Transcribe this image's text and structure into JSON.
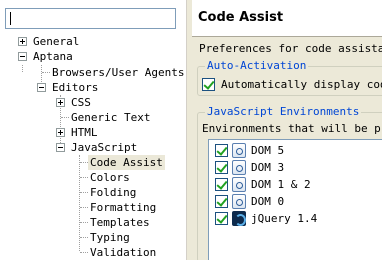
{
  "filter": {
    "value": ""
  },
  "tree": [
    {
      "label": "General",
      "expander": "plus"
    },
    {
      "label": "Aptana",
      "expander": "minus"
    },
    {
      "label": "Browsers/User Agents",
      "expander": "none"
    },
    {
      "label": "Editors",
      "expander": "minus"
    },
    {
      "label": "CSS",
      "expander": "plus"
    },
    {
      "label": "Generic Text",
      "expander": "none"
    },
    {
      "label": "HTML",
      "expander": "plus"
    },
    {
      "label": "JavaScript",
      "expander": "minus"
    },
    {
      "label": "Code Assist",
      "expander": "none",
      "selected": true
    },
    {
      "label": "Colors",
      "expander": "none"
    },
    {
      "label": "Folding",
      "expander": "none"
    },
    {
      "label": "Formatting",
      "expander": "none"
    },
    {
      "label": "Templates",
      "expander": "none"
    },
    {
      "label": "Typing",
      "expander": "none"
    },
    {
      "label": "Validation",
      "expander": "none"
    }
  ],
  "page": {
    "title": "Code Assist",
    "preferences_text": "Preferences for code assistance",
    "auto_activation": {
      "group_title": "Auto-Activation",
      "checkbox_label": "Automatically display code",
      "checked": true
    },
    "js_environments": {
      "group_title": "JavaScript Environments",
      "description": "Environments that will be pre",
      "items": [
        {
          "label": "DOM 5",
          "checked": true,
          "icon": "dom-icon"
        },
        {
          "label": "DOM 3",
          "checked": true,
          "icon": "dom-icon"
        },
        {
          "label": "DOM 1 & 2",
          "checked": true,
          "icon": "dom-icon"
        },
        {
          "label": "DOM 0",
          "checked": true,
          "icon": "dom-icon"
        },
        {
          "label": "jQuery 1.4",
          "checked": true,
          "icon": "jquery-icon"
        }
      ]
    }
  },
  "colors": {
    "group_title": "#0046d5",
    "panel_bg": "#ece9d8",
    "selection_bg": "#ebe8d8",
    "check_green": "#21a121"
  }
}
